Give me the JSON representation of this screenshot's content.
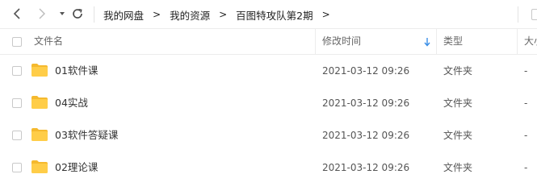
{
  "toolbar": {
    "back_icon": "chevron-left-icon",
    "forward_icon": "chevron-right-icon",
    "history_icon": "caret-down-icon",
    "refresh_icon": "refresh-icon",
    "breadcrumb": [
      "我的网盘",
      "我的资源",
      "百图特攻队第2期"
    ],
    "separator": ">"
  },
  "columns": {
    "name": "文件名",
    "modified": "修改时间",
    "type": "类型",
    "size": "大小"
  },
  "sort_icon": "arrow-down-icon",
  "files": [
    {
      "name": "01软件课",
      "modified": "2021-03-12 09:26",
      "type": "文件夹",
      "size": "-"
    },
    {
      "name": "04实战",
      "modified": "2021-03-12 09:26",
      "type": "文件夹",
      "size": "-"
    },
    {
      "name": "03软件答疑课",
      "modified": "2021-03-12 09:26",
      "type": "文件夹",
      "size": "-"
    },
    {
      "name": "02理论课",
      "modified": "2021-03-12 09:26",
      "type": "文件夹",
      "size": "-"
    }
  ],
  "colors": {
    "folder": "#ffcd48",
    "folder_tab": "#f5b92e",
    "sort_accent": "#3a8ee6",
    "border": "#ececec"
  }
}
